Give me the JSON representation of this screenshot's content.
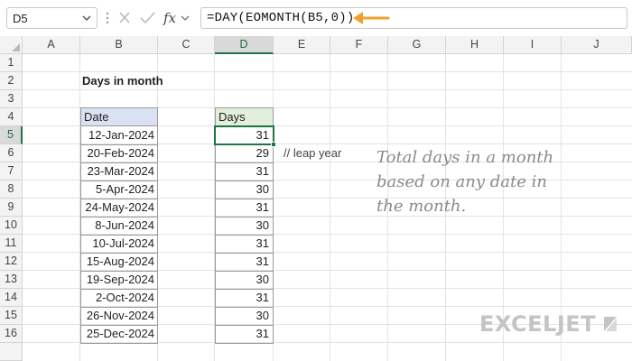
{
  "formula_bar": {
    "name_box": "D5",
    "formula": "=DAY(EOMONTH(B5,0))",
    "fx_label": "fx",
    "arrow_color": "#f0a12b"
  },
  "columns": [
    "A",
    "B",
    "C",
    "D",
    "E",
    "F",
    "G",
    "H",
    "I",
    "J"
  ],
  "rows": [
    "1",
    "2",
    "3",
    "4",
    "5",
    "6",
    "7",
    "8",
    "9",
    "10",
    "11",
    "12",
    "13",
    "14",
    "15",
    "16"
  ],
  "active_cell": {
    "column": "D",
    "row": "5"
  },
  "sheet": {
    "title": "Days in month",
    "date_header": "Date",
    "days_header": "Days",
    "dates": [
      "12-Jan-2024",
      "20-Feb-2024",
      "23-Mar-2024",
      "5-Apr-2024",
      "24-May-2024",
      "8-Jun-2024",
      "10-Jul-2024",
      "15-Aug-2024",
      "19-Sep-2024",
      "2-Oct-2024",
      "26-Nov-2024",
      "25-Dec-2024"
    ],
    "days": [
      "31",
      "29",
      "31",
      "30",
      "31",
      "30",
      "31",
      "31",
      "30",
      "31",
      "30",
      "31"
    ],
    "note": "//  leap year"
  },
  "callout": {
    "line1": "Total days in a month",
    "line2": "based on any date in",
    "line3": "the month."
  },
  "logo": {
    "text": "EXCELJET",
    "mark_color": "#c4c4c4"
  },
  "colors": {
    "selection": "#217346",
    "date_header_fill": "#d9e1f2",
    "days_header_fill": "#e2efda"
  }
}
